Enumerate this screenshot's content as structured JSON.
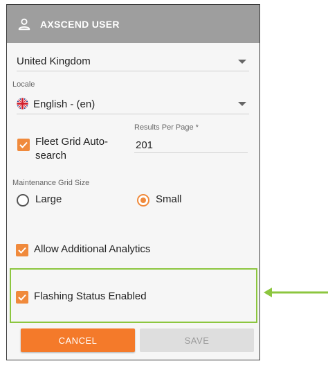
{
  "header": {
    "title": "AXSCEND USER",
    "icon": "person-icon"
  },
  "country": {
    "value": "United Kingdom"
  },
  "locale": {
    "label": "Locale",
    "value": "English - (en)",
    "flag": "uk-flag-icon"
  },
  "fleet_grid": {
    "label": "Fleet Grid Auto-search",
    "checked": true
  },
  "results_per_page": {
    "label": "Results Per Page",
    "required_marker": "*",
    "value": "201"
  },
  "maintenance_grid_size": {
    "label": "Maintenance Grid Size",
    "options": [
      {
        "label": "Large",
        "selected": false
      },
      {
        "label": "Small",
        "selected": true
      }
    ]
  },
  "analytics": {
    "label": "Allow Additional Analytics",
    "checked": true
  },
  "flashing_status": {
    "label": "Flashing Status Enabled",
    "checked": true
  },
  "buttons": {
    "cancel": "CANCEL",
    "save": "SAVE"
  },
  "colors": {
    "accent": "#f47a2a",
    "header_bg": "#9e9e9e",
    "highlight": "#8cc63f"
  }
}
